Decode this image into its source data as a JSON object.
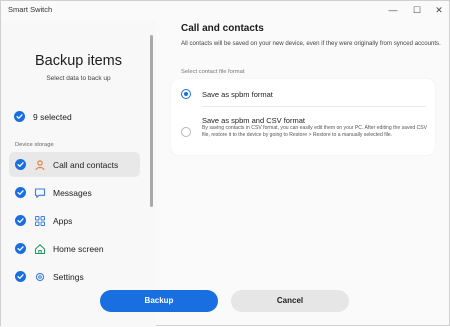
{
  "window": {
    "title": "Smart Switch",
    "controls": {
      "minimize": "—",
      "maximize": "☐",
      "close": "✕"
    }
  },
  "sidebar": {
    "title": "Backup items",
    "subtitle": "Select data to back up",
    "selected_count": "9 selected",
    "group_label": "Device storage",
    "items": [
      {
        "label": "Call and contacts",
        "icon": "person-icon",
        "checked": true,
        "active": true
      },
      {
        "label": "Messages",
        "icon": "message-icon",
        "checked": true,
        "active": false
      },
      {
        "label": "Apps",
        "icon": "apps-grid-icon",
        "checked": true,
        "active": false
      },
      {
        "label": "Home screen",
        "icon": "home-icon",
        "checked": true,
        "active": false
      },
      {
        "label": "Settings",
        "icon": "gear-icon",
        "checked": true,
        "active": false
      }
    ]
  },
  "main": {
    "title": "Call and contacts",
    "description": "All contacts will be saved on your new device, even if they were originally from synced accounts.",
    "format_label": "Select contact file format",
    "options": [
      {
        "label": "Save as spbm format",
        "selected": true,
        "description": ""
      },
      {
        "label": "Save as spbm and CSV format",
        "selected": false,
        "description": "By saving contacts in CSV format, you can easily edit them on your PC. After editing the saved CSV file, restore it to the device by going to Restore > Restore to a manually selected file."
      }
    ]
  },
  "footer": {
    "backup_label": "Backup",
    "cancel_label": "Cancel"
  },
  "colors": {
    "accent": "#1a6fe0",
    "icon_orange": "#e8793a",
    "icon_blue": "#3b7fd9",
    "icon_green": "#2b9a6a"
  }
}
